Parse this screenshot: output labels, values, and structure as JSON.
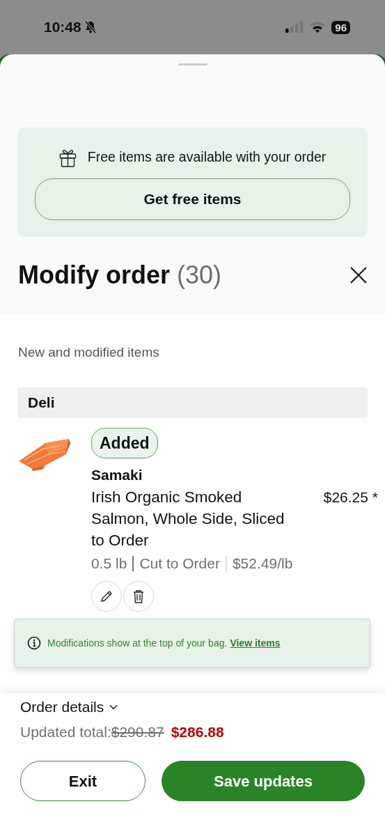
{
  "status_bar": {
    "time": "10:48",
    "battery": "96"
  },
  "promo": {
    "message": "Free items are available with your order",
    "button": "Get free items"
  },
  "header": {
    "title": "Modify order",
    "count": "(30)"
  },
  "section_label": "New and modified items",
  "groups": [
    {
      "name": "Deli",
      "items": [
        {
          "status": "Added",
          "brand": "Samaki",
          "name": "Irish Organic Smoked Salmon, Whole Side, Sliced to Order",
          "price": "$26.25 *",
          "details": [
            "0.5 lb",
            "Cut to Order",
            "$52.49/lb"
          ]
        }
      ]
    }
  ],
  "toast": {
    "message": "Modifications show at the top of your bag.",
    "link": "View items"
  },
  "footer": {
    "details_toggle": "Order details",
    "total_label": "Updated total:",
    "old_total": "$290.87",
    "new_total": "$286.88",
    "buttons": [
      {
        "label": "Exit",
        "kind": "outline"
      },
      {
        "label": "Save updates",
        "kind": "primary"
      }
    ]
  }
}
